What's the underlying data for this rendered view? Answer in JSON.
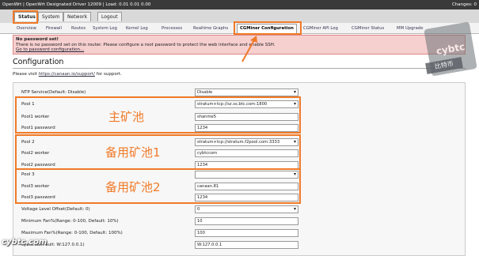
{
  "topbar": {
    "title": "OpenWrt | OpenWrt Designated Driver 12009 | Load: 0.01 0.01 0.00",
    "changes": "Changes: 0"
  },
  "main_tabs": [
    "Status",
    "System",
    "Network",
    "Logout"
  ],
  "sub_tabs": [
    "Overview",
    "Firewall",
    "Routes",
    "System Log",
    "Kernel Log",
    "Processes",
    "Realtime Graphs",
    "CGMiner Configuration",
    "CGMiner API Log",
    "CGMiner Status",
    "MM Upgrade"
  ],
  "warning": {
    "title": "No password set!",
    "text": "There is no password set on this router. Please configure a root password to protect the web interface and enable SSH.",
    "link": "Go to password configuration..."
  },
  "config": {
    "title": "Configuration",
    "visit_prefix": "Please visit",
    "visit_link": "https://canaan.io/support/",
    "visit_suffix": "for support."
  },
  "fields": {
    "ntp_label": "NTP Service(Default: Disable)",
    "ntp_value": "Disable",
    "pool1_label": "Pool 1",
    "pool1_value": "stratum+tcp://sz.ss.btc.com:1800",
    "pool1_worker_label": "Pool1 worker",
    "pool1_worker_value": "shanme5",
    "pool1_password_label": "Pool1 password",
    "pool1_password_value": "1234",
    "pool2_label": "Pool 2",
    "pool2_value": "stratum+tcp://stratum.f2pool.com:3333",
    "pool2_worker_label": "Pool2 worker",
    "pool2_worker_value": "cybtccom",
    "pool2_password_label": "Pool2 password",
    "pool2_password_value": "1234",
    "pool3_label": "Pool 3",
    "pool3_value": "",
    "pool3_worker_label": "Pool3 worker",
    "pool3_worker_value": "canaan.81",
    "pool3_password_label": "Pool3 password",
    "pool3_password_value": "1234",
    "voltage_label": "Voltage Level Offset(Default: 0)",
    "voltage_value": "0",
    "minfan_label": "Minimum Fan%(Range: 0-100, Default: 10%)",
    "minfan_value": "10",
    "maxfan_label": "Maximum Fan%(Range: 0-100, Default: 100%)",
    "maxfan_value": "100",
    "api_label": "cybtc.com ault: W:127.0.0.1)",
    "api_value": "W:127.0.0.1"
  },
  "annotations": {
    "main_pool": "主矿池",
    "backup_pool1": "备用矿池1",
    "backup_pool2": "备用矿池2"
  },
  "watermarks": {
    "badge": "cybtc",
    "badge_cn": "比特币",
    "bottom": "cybtc.com"
  },
  "colors": {
    "highlight": "#f07a28",
    "warning_bg": "#f6cfcf",
    "topbar_bg": "#3a3a3a"
  }
}
